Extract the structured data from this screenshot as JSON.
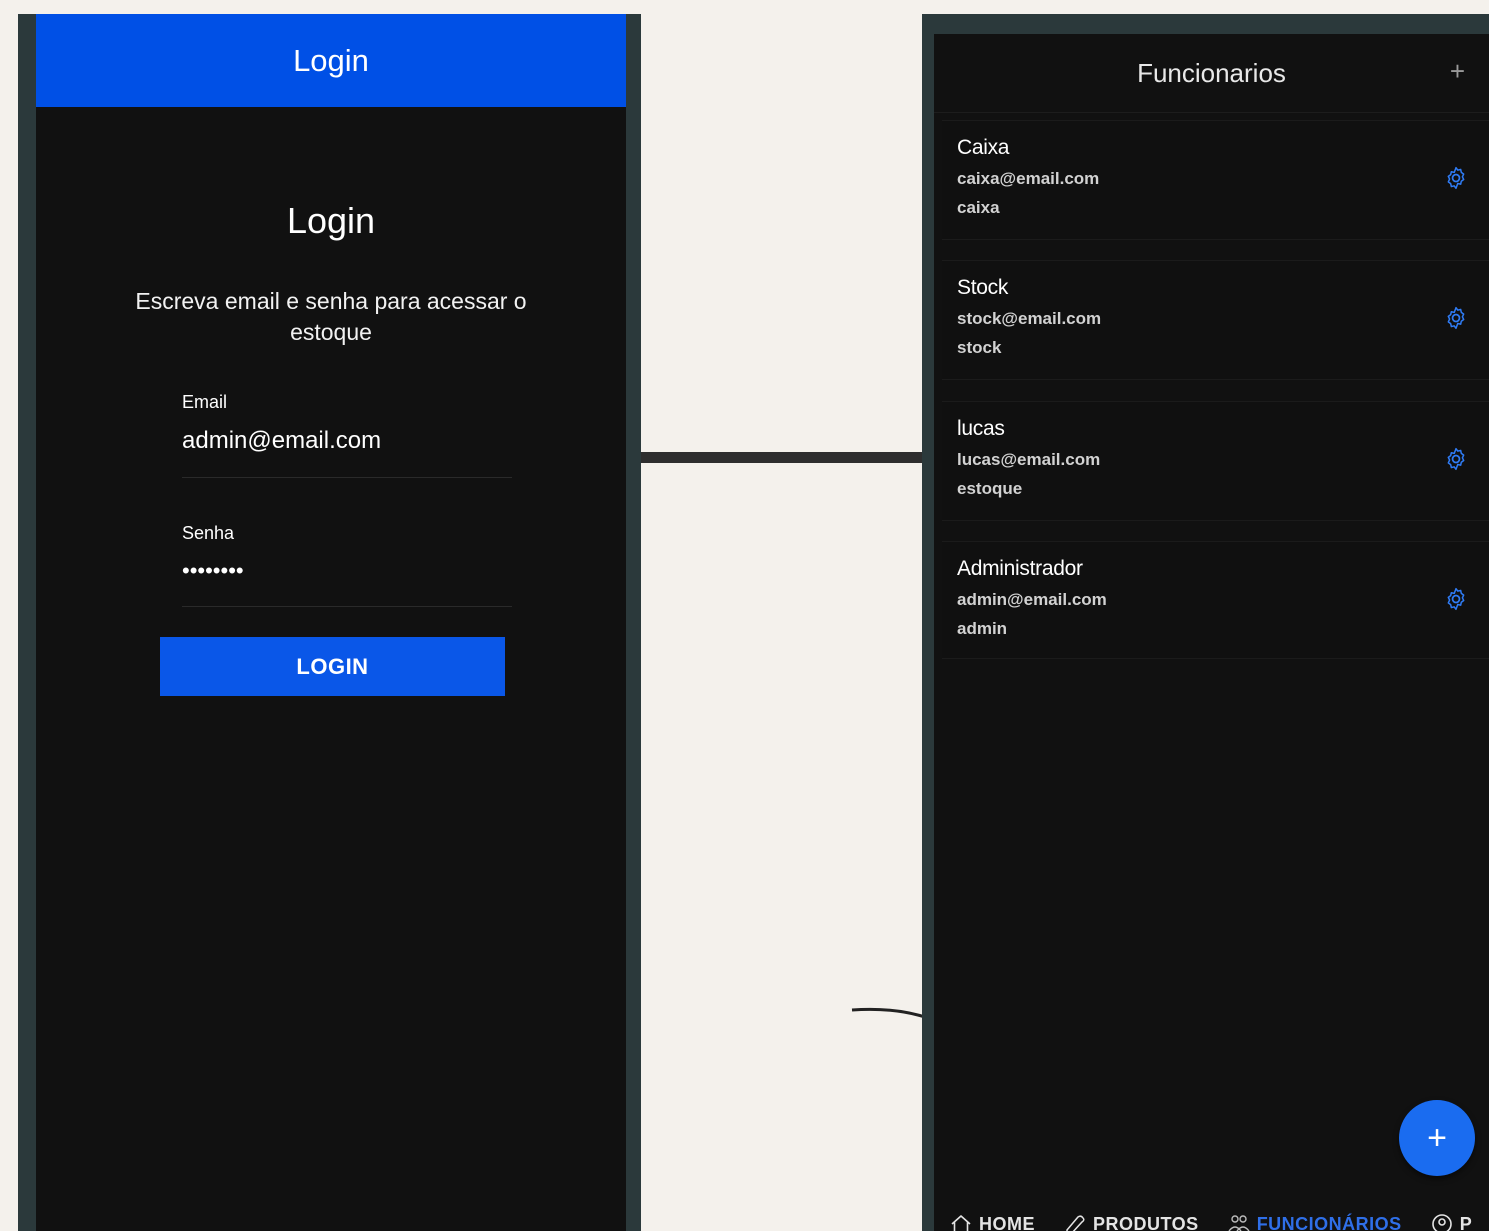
{
  "colors": {
    "accent": "#0050e6",
    "background": "#111111",
    "frame": "#2b393b",
    "canvas": "#f4f1ec",
    "active_nav": "#2f6fe8"
  },
  "login_screen": {
    "appbar_title": "Login",
    "heading": "Login",
    "subtitle": "Escreva email e senha para acessar o estoque",
    "email_label": "Email",
    "email_value": "admin@email.com",
    "password_label": "Senha",
    "password_value": "••••••••",
    "login_button": "LOGIN"
  },
  "funcionarios_screen": {
    "title": "Funcionarios",
    "header_add_icon": "plus-icon",
    "employees": [
      {
        "name": "Caixa",
        "email": "caixa@email.com",
        "role": "caixa"
      },
      {
        "name": "Stock",
        "email": "stock@email.com",
        "role": "stock"
      },
      {
        "name": "lucas",
        "email": "lucas@email.com",
        "role": "estoque"
      },
      {
        "name": "Administrador",
        "email": "admin@email.com",
        "role": "admin"
      }
    ],
    "settings_icon": "gear-icon",
    "fab_icon": "plus-icon",
    "bottom_nav": [
      {
        "label": "HOME",
        "icon": "home-icon"
      },
      {
        "label": "PRODUTOS",
        "icon": "tag-icon"
      },
      {
        "label": "FUNCIONÁRIOS",
        "icon": "people-icon",
        "active": true
      },
      {
        "label": "P",
        "icon": "profile-icon"
      }
    ]
  }
}
